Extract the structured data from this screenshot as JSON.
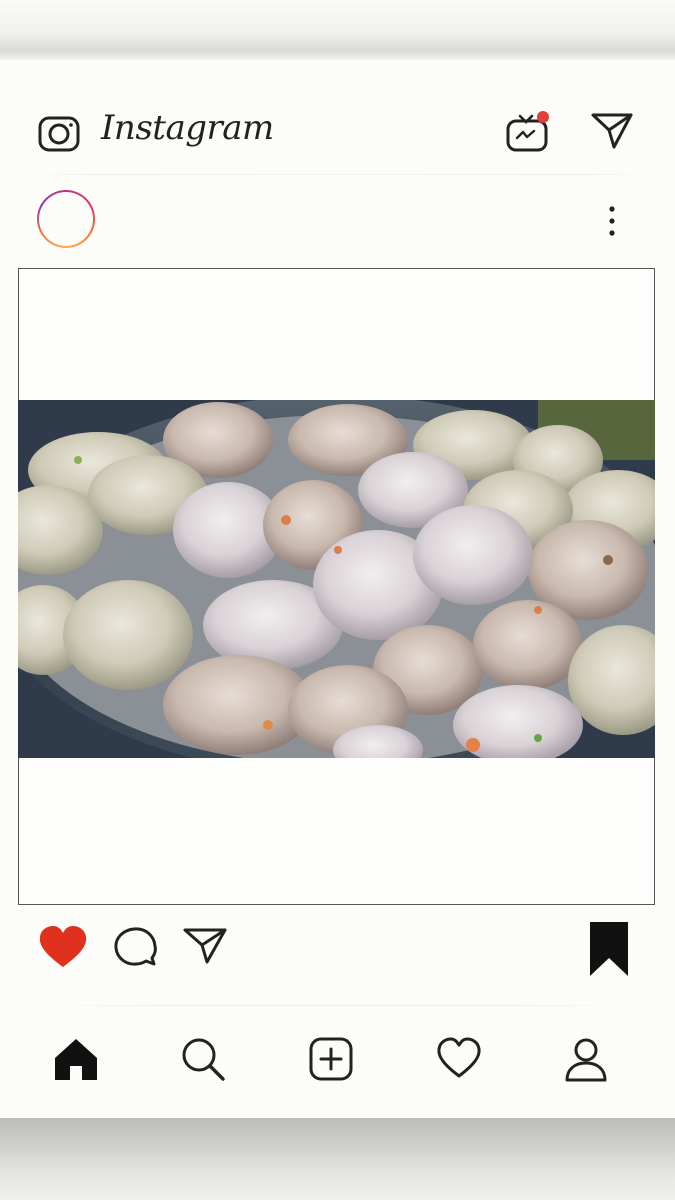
{
  "app": {
    "title": "Instagram"
  },
  "header": {
    "camera_icon": "camera-icon",
    "igtv_icon": "igtv-icon",
    "direct_icon": "paper-plane-icon",
    "igtv_badge_color": "#e0403a"
  },
  "post": {
    "more_icon": "vertical-ellipsis-icon",
    "image_subject": "dumplings-in-steamer-photo",
    "liked": true,
    "saved": true
  },
  "actions": {
    "like_color": "#e0301e",
    "icons": [
      "heart-icon",
      "comment-icon",
      "paper-plane-icon",
      "bookmark-icon"
    ]
  },
  "bottom_nav": {
    "items": [
      "home-icon",
      "search-icon",
      "add-post-icon",
      "activity-heart-icon",
      "profile-icon"
    ],
    "active": "home-icon"
  }
}
